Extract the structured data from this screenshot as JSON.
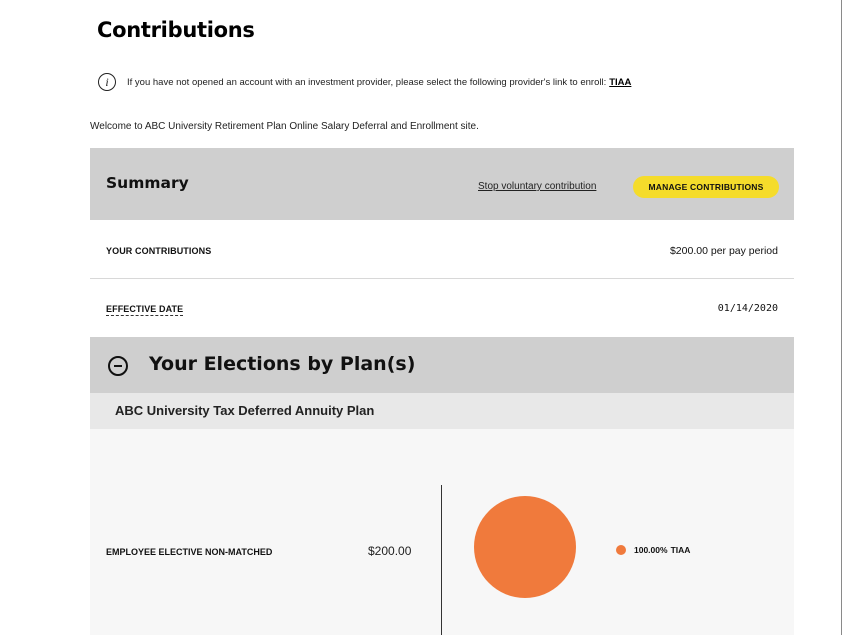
{
  "page": {
    "title": "Contributions"
  },
  "notice": {
    "text": "If you have not opened an account with an investment provider, please select the following provider's link to enroll:",
    "link_label": "TIAA",
    "icon": "info-icon"
  },
  "welcome": "Welcome to ABC University Retirement Plan Online Salary Deferral and Enrollment site.",
  "summary": {
    "title": "Summary",
    "stop_link": "Stop voluntary contribution",
    "manage_button": "MANAGE CONTRIBUTIONS",
    "contributions_label": "YOUR CONTRIBUTIONS",
    "contributions_amount": "$200.00",
    "contributions_unit": "per pay period",
    "effective_date_label": "EFFECTIVE DATE",
    "effective_date": "01/14/2020"
  },
  "elections": {
    "title": "Your Elections by Plan(s)",
    "collapse_icon": "minus-circle-icon",
    "plans": [
      {
        "name": "ABC University Tax Deferred Annuity Plan",
        "sources": [
          {
            "label": "EMPLOYEE ELECTIVE NON-MATCHED",
            "amount": "$200.00"
          }
        ]
      }
    ]
  },
  "chart_data": {
    "type": "pie",
    "slices": [
      {
        "label": "TIAA",
        "percent": 100.0,
        "display": "100.00%",
        "color": "#f07a3c"
      }
    ]
  },
  "colors": {
    "accent_yellow": "#f5dc2b",
    "pie_orange": "#f07a3c",
    "header_gray": "#cfcfcf"
  }
}
